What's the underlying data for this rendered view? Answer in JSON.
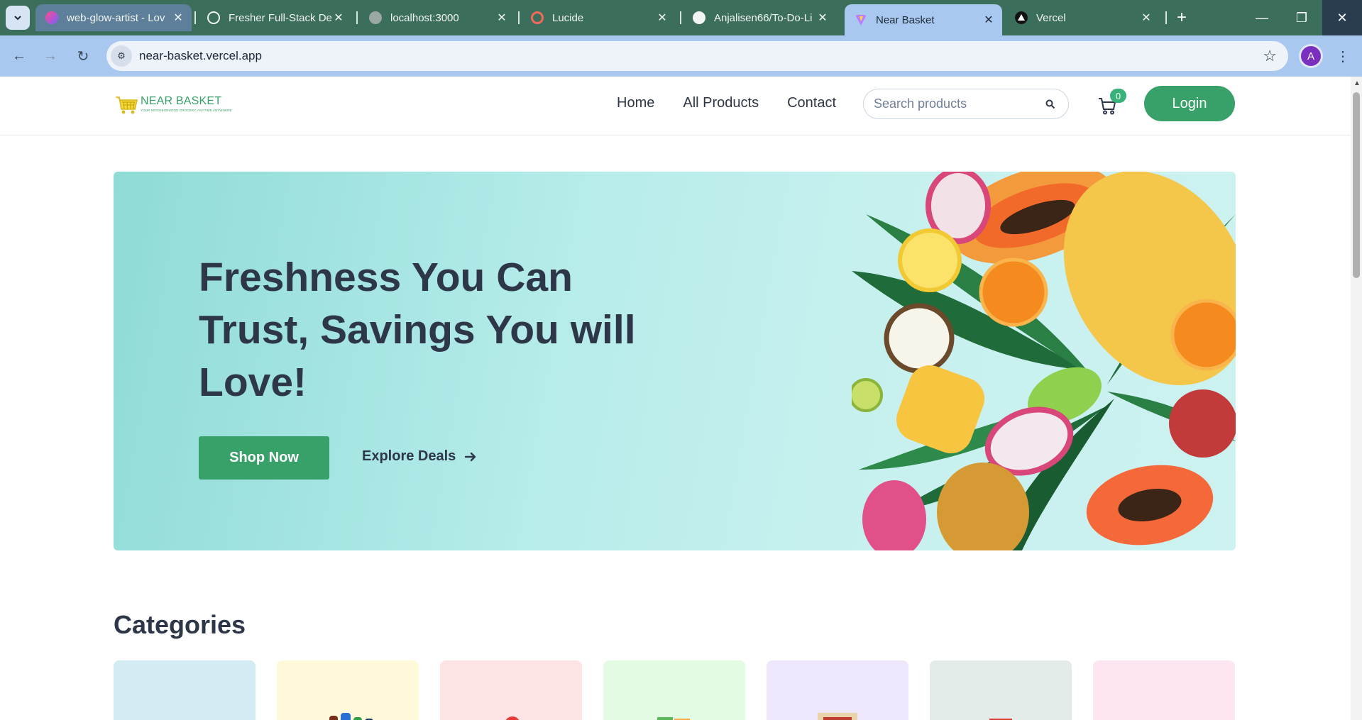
{
  "browser": {
    "tabs": [
      {
        "title": "web-glow-artist - Lov",
        "favicon": "lovable-heart-icon",
        "active": false
      },
      {
        "title": "Fresher Full-Stack De",
        "favicon": "openai-icon",
        "active": false
      },
      {
        "title": "localhost:3000",
        "favicon": "globe-icon",
        "active": false
      },
      {
        "title": "Lucide",
        "favicon": "lucide-icon",
        "active": false
      },
      {
        "title": "Anjalisen66/To-Do-Li",
        "favicon": "github-icon",
        "active": false
      },
      {
        "title": "Near Basket",
        "favicon": "vite-icon",
        "active": true
      },
      {
        "title": "Vercel",
        "favicon": "vercel-icon",
        "active": false
      }
    ],
    "url": "near-basket.vercel.app",
    "profile_initial": "A",
    "accent_color": "#a8c8f0"
  },
  "header": {
    "logo_name": "NEAR BASKET",
    "logo_tagline": "YOUR NEIGHBORHOOD GROCERY, ANYTIME ANYWHERE",
    "nav": [
      "Home",
      "All Products",
      "Contact"
    ],
    "search_placeholder": "Search products",
    "cart_count": "0",
    "login_label": "Login",
    "brand_color": "#38a169"
  },
  "hero": {
    "title": "Freshness You Can Trust, Savings You will Love!",
    "primary_cta": "Shop Now",
    "secondary_cta": "Explore Deals",
    "image": "tropical-fruits-illustration"
  },
  "categories": {
    "title": "Categories",
    "cards": [
      {
        "bg": "#d3ebf3",
        "image": "dairy-packs"
      },
      {
        "bg": "#fdf9d9",
        "image": "soft-drink-bottles"
      },
      {
        "bg": "#fde3e3",
        "image": "vegetable-basket"
      },
      {
        "bg": "#e3fbe3",
        "image": "snack-packets"
      },
      {
        "bg": "#eee6fb",
        "image": "flour-bag"
      },
      {
        "bg": "#e4ece9",
        "image": "biscuit-packs"
      },
      {
        "bg": "#fde6f1",
        "image": "assorted-packs"
      }
    ]
  }
}
